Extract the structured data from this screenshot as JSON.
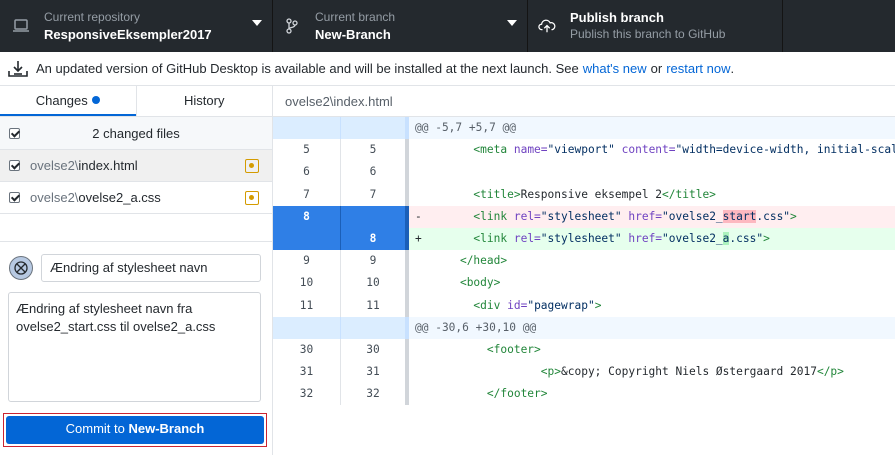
{
  "toolbar": {
    "repo_label": "Current repository",
    "repo_value": "ResponsiveEksempler2017",
    "branch_label": "Current branch",
    "branch_value": "New-Branch",
    "publish_title": "Publish branch",
    "publish_subtitle": "Publish this branch to GitHub"
  },
  "banner": {
    "text": "An updated version of GitHub Desktop is available and will be installed at the next launch. See",
    "link1": "what's new",
    "or": "or",
    "link2": "restart now",
    "end": "."
  },
  "sidebar": {
    "tab_changes": "Changes",
    "tab_history": "History",
    "changed_files": "2 changed files",
    "files": [
      {
        "dir": "ovelse2\\",
        "name": "index.html"
      },
      {
        "dir": "ovelse2\\",
        "name": "ovelse2_a.css"
      }
    ],
    "summary": "Ændring af stylesheet navn",
    "description": "Ændring af stylesheet navn fra ovelse2_start.css til ovelse2_a.css",
    "commit_prefix": "Commit to ",
    "commit_branch": "New-Branch"
  },
  "main": {
    "path": "ovelse2\\index.html",
    "hunk1": "@@ -5,7 +5,7 @@",
    "hunk2": "@@ -30,6 +30,10 @@",
    "lines": [
      {
        "old": "5",
        "new": "5"
      },
      {
        "old": "6",
        "new": "6"
      },
      {
        "old": "7",
        "new": "7"
      },
      {
        "old": "8",
        "new": ""
      },
      {
        "old": "",
        "new": "8"
      },
      {
        "old": "9",
        "new": "9"
      },
      {
        "old": "10",
        "new": "10"
      },
      {
        "old": "11",
        "new": "11"
      },
      {
        "old": "30",
        "new": "30"
      },
      {
        "old": "31",
        "new": "31"
      },
      {
        "old": "32",
        "new": "32"
      }
    ],
    "code": {
      "meta_open": "<meta ",
      "meta_name_attr": "name=",
      "meta_name_val": "\"viewport\"",
      "meta_content_attr": " content=",
      "meta_content_val": "\"width=device-width, initial-scal",
      "title_open": "<title>",
      "title_text": "Responsive eksempel 2",
      "title_close": "</title>",
      "link_open": "<link ",
      "rel_attr": "rel=",
      "rel_val": "\"stylesheet\"",
      "href_attr": " href=",
      "del_href_pre": "\"ovelse2_",
      "del_href_mark": "start",
      "del_href_post": ".css\"",
      "add_href_pre": "\"ovelse2_",
      "add_href_mark": "a",
      "add_href_post": ".css\"",
      "link_end": ">",
      "head_close": "</head>",
      "body_open": "<body>",
      "div_open": "<div ",
      "id_attr": "id=",
      "id_val": "\"pagewrap\"",
      "div_end": ">",
      "footer_open": "<footer>",
      "p_open": "<p>",
      "p_text": "&copy; Copyright Niels Østergaard 2017",
      "p_close": "</p>",
      "footer_close": "</footer>",
      "sign_del": "-",
      "sign_add": "+"
    }
  }
}
